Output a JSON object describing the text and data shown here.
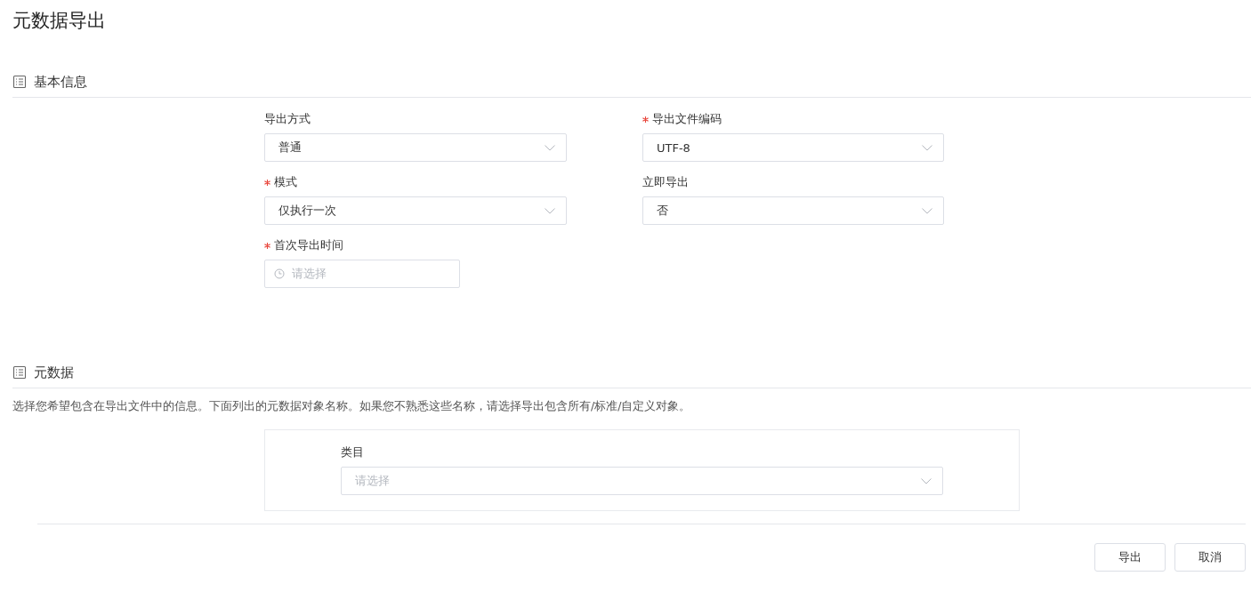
{
  "page_title": "元数据导出",
  "basic_info": {
    "title": "基本信息",
    "fields": [
      {
        "kind": "select",
        "label": "导出方式",
        "required": false,
        "value": "普通"
      },
      {
        "kind": "select",
        "label": "导出文件编码",
        "required": true,
        "value": "UTF-8"
      },
      {
        "kind": "select",
        "label": "模式",
        "required": true,
        "value": "仅执行一次"
      },
      {
        "kind": "select",
        "label": "立即导出",
        "required": false,
        "value": "否"
      },
      {
        "kind": "date",
        "label": "首次导出时间",
        "required": true,
        "placeholder": "请选择"
      }
    ]
  },
  "metadata": {
    "title": "元数据",
    "description": "选择您希望包含在导出文件中的信息。下面列出的元数据对象名称。如果您不熟悉这些名称，请选择导出包含所有/标准/自定义对象。",
    "category": {
      "kind": "select",
      "label": "类目",
      "required": false,
      "placeholder": "请选择"
    }
  },
  "buttons": [
    "导出",
    "取消"
  ]
}
